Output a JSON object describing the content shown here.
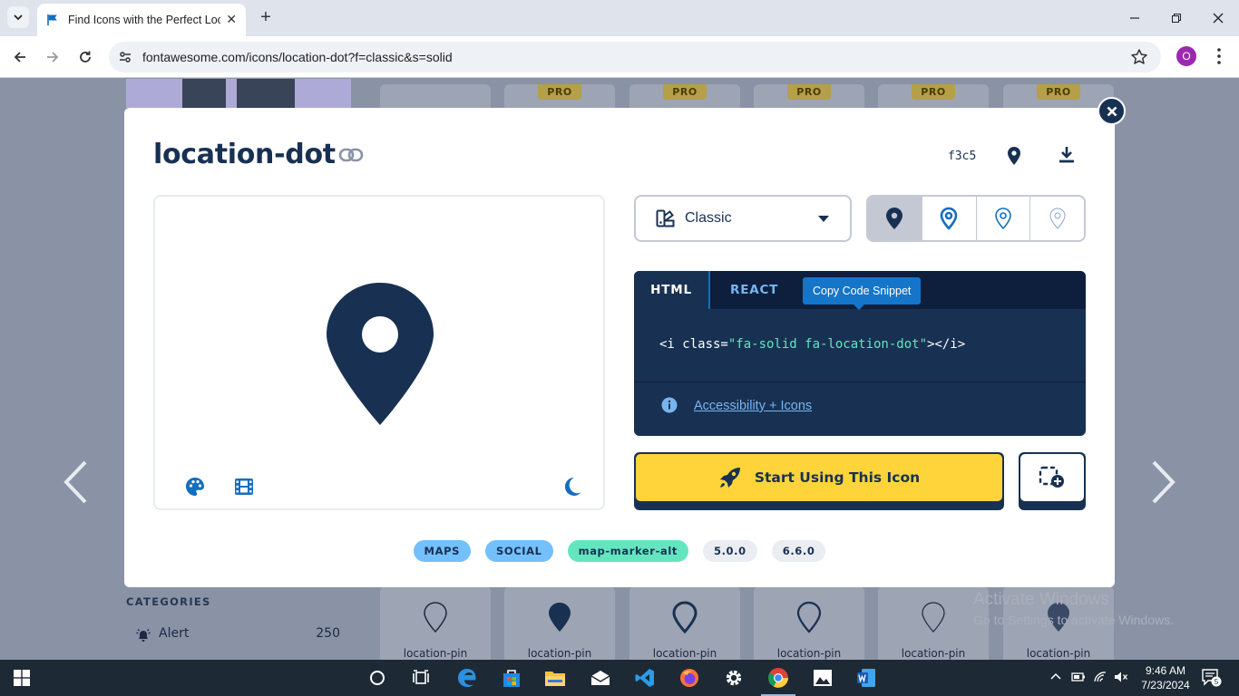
{
  "browser": {
    "tab_title": "Find Icons with the Perfect Look & Feel | Font Awesome",
    "url": "fontawesome.com/icons/location-dot?f=classic&s=solid",
    "profile_initial": "O"
  },
  "background": {
    "pro_badge": "PRO",
    "categories_heading": "CATEGORIES",
    "category_name": "Alert",
    "category_count": "250",
    "cards": [
      "location-pin",
      "location-pin",
      "location-pin",
      "location-pin",
      "location-pin",
      "location-pin"
    ],
    "watermark_title": "Activate Windows",
    "watermark_sub": "Go to Settings to activate Windows."
  },
  "modal": {
    "title": "location-dot",
    "unicode": "f3c5",
    "family": "Classic",
    "styles": [
      "solid",
      "regular",
      "light",
      "thin"
    ],
    "active_style": "solid",
    "code_tabs": {
      "html": "HTML",
      "react": "REACT"
    },
    "copy_tooltip": "Copy Code Snippet",
    "snippet": {
      "open": "<i class=",
      "value": "\"fa-solid fa-location-dot\"",
      "close": "></i>"
    },
    "accessibility_link": "Accessibility + Icons",
    "start_button": "Start Using This Icon",
    "tags": [
      {
        "label": "MAPS",
        "kind": "category"
      },
      {
        "label": "SOCIAL",
        "kind": "category"
      },
      {
        "label": "map-marker-alt",
        "kind": "alias"
      },
      {
        "label": "5.0.0",
        "kind": "version"
      },
      {
        "label": "6.6.0",
        "kind": "version"
      }
    ]
  },
  "colors": {
    "navy": "#183153",
    "yellow": "#ffd43b",
    "blue": "#74c0fc",
    "green": "#63e6be",
    "link": "#1575c9"
  },
  "taskbar": {
    "time": "9:46 AM",
    "date": "7/23/2024",
    "notifications": "5"
  }
}
